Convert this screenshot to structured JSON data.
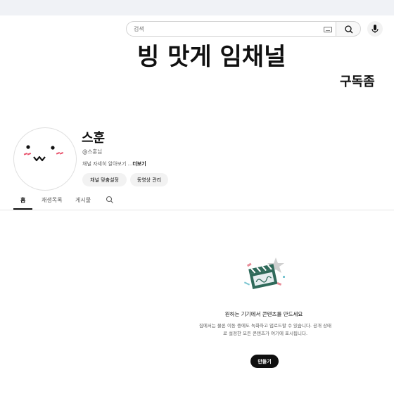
{
  "search": {
    "placeholder": "검색"
  },
  "banner": {
    "text": "빙 맛게 임채널",
    "subtext": "구독좀"
  },
  "channel": {
    "name": "스훈",
    "handle": "@스훈님",
    "description": "채널 자세히 알아보기 ...",
    "more_label": "더보기",
    "buttons": {
      "customize": "채널 맞춤설정",
      "manage_videos": "동영상 관리"
    }
  },
  "tabs": [
    {
      "label": "홈",
      "active": true
    },
    {
      "label": "재생목록",
      "active": false
    },
    {
      "label": "게시물",
      "active": false
    }
  ],
  "empty_state": {
    "title": "원하는 기기에서 콘텐츠를 만드세요",
    "body": "집에서는 물론 이동 중에도 녹화하고 업로드할 수 있습니다. 공개 상태로 설정한 모든 콘텐츠가 여기에 표시됩니다.",
    "create_label": "만들기"
  },
  "icons": [
    "keyboard-icon",
    "search-icon",
    "mic-icon",
    "tab-search-icon",
    "clapperboard-illustration"
  ],
  "colors": {
    "text": "#0f0f0f",
    "secondary": "#606060",
    "pill_bg": "#f2f2f2",
    "avatar_blush": "#e8506a"
  }
}
